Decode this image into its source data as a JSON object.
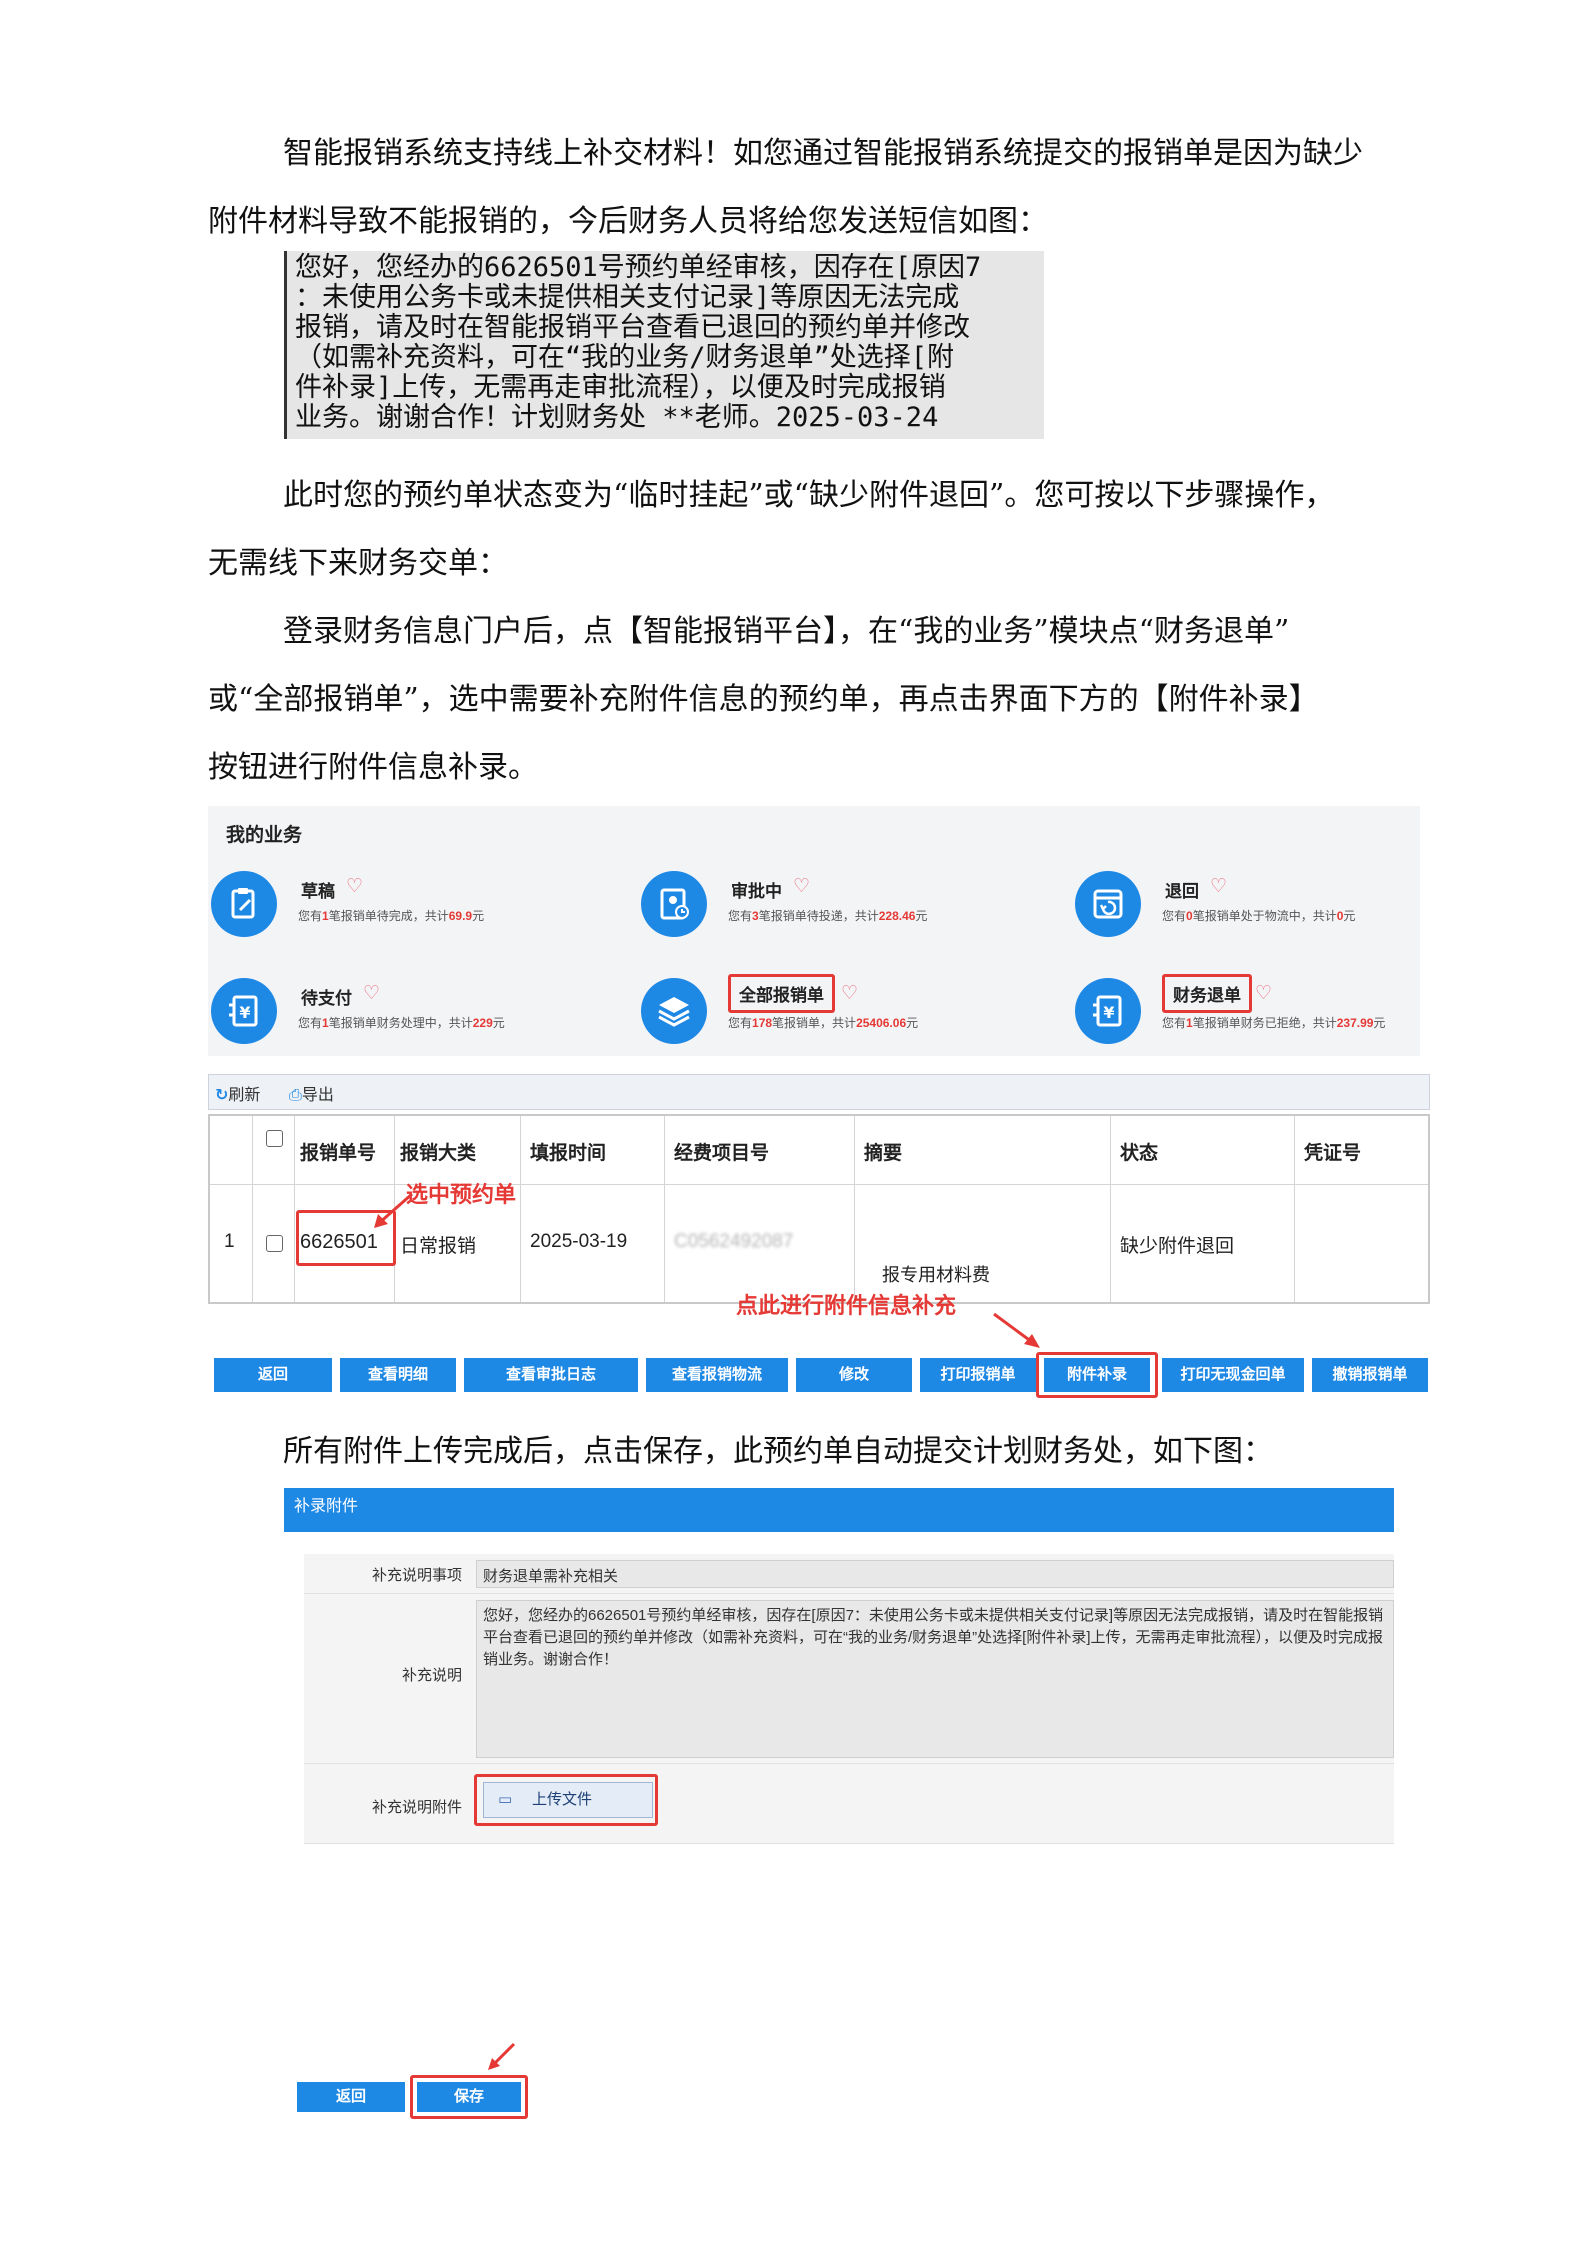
{
  "intro": {
    "line1": "智能报销系统支持线上补交材料！如您通过智能报销系统提交的报销单是因为缺少",
    "line2": "附件材料导致不能报销的，今后财务人员将给您发送短信如图："
  },
  "sms": "您好，您经办的6626501号预约单经审核，因存在[原因7\n：未使用公务卡或未提供相关支付记录]等原因无法完成\n报销，请及时在智能报销平台查看已退回的预约单并修改\n（如需补充资料，可在“我的业务/财务退单”处选择[附\n件补录]上传，无需再走审批流程），以便及时完成报销\n业务。谢谢合作！计划财务处 **老师。2025-03-24",
  "para2": {
    "line1": "此时您的预约单状态变为“临时挂起”或“缺少附件退回”。您可按以下步骤操作，",
    "line2": "无需线下来财务交单："
  },
  "para3": {
    "line1": "登录财务信息门户后，点【智能报销平台】，在“我的业务”模块点“财务退单”",
    "line2": "或“全部报销单”，选中需要补充附件信息的预约单，再点击界面下方的【附件补录】",
    "line3": "按钮进行附件信息补录。"
  },
  "business": {
    "title": "我的业务",
    "tiles": [
      {
        "name": "草稿",
        "desc_pre": "您有",
        "count": "1",
        "desc_mid": "笔报销单待完成，共计",
        "amount": "69.9",
        "desc_post": "元",
        "icon": "clipboard-edit-icon"
      },
      {
        "name": "审批中",
        "desc_pre": "您有",
        "count": "3",
        "desc_mid": "笔报销单待投递，共计",
        "amount": "228.46",
        "desc_post": "元",
        "icon": "badge-clock-icon"
      },
      {
        "name": "退回",
        "desc_pre": "您有",
        "count": "0",
        "desc_mid": "笔报销单处于物流中，共计",
        "amount": "0",
        "desc_post": "元",
        "icon": "return-icon"
      },
      {
        "name": "待支付",
        "desc_pre": "您有",
        "count": "1",
        "desc_mid": "笔报销单财务处理中，共计",
        "amount": "229",
        "desc_post": "元",
        "icon": "yuan-doc-icon"
      },
      {
        "name": "全部报销单",
        "desc_pre": "您有",
        "count": "178",
        "desc_mid": "笔报销单，共计",
        "amount": "25406.06",
        "desc_post": "元",
        "icon": "layers-icon"
      },
      {
        "name": "财务退单",
        "desc_pre": "您有",
        "count": "1",
        "desc_mid": "笔报销单财务已拒绝，共计",
        "amount": "237.99",
        "desc_post": "元",
        "icon": "yuan-doc-icon"
      }
    ]
  },
  "table": {
    "toolbar": {
      "refresh": "刷新",
      "export": "导出"
    },
    "headers": [
      "报销单号",
      "报销大类",
      "填报时间",
      "经费项目号",
      "摘要",
      "状态",
      "凭证号"
    ],
    "row": {
      "index": "1",
      "id": "6626501",
      "category": "日常报销",
      "date": "2025-03-19",
      "project": "C0562492087",
      "summary_line3": "报专用材料费",
      "status": "缺少附件退回"
    },
    "annot_select": "选中预约单",
    "annot_click": "点此进行附件信息补充",
    "buttons": [
      "返回",
      "查看明细",
      "查看审批日志",
      "查看报销物流",
      "修改",
      "打印报销单",
      "附件补录",
      "打印无现金回单",
      "撤销报销单"
    ]
  },
  "para4": "所有附件上传完成后，点击保存，此预约单自动提交计划财务处，如下图：",
  "attach": {
    "header": "补录附件",
    "label_item": "补充说明事项",
    "value_item": "财务退单需补充相关",
    "label_desc": "补充说明",
    "value_desc": "您好，您经办的6626501号预约单经审核，因存在[原因7：未使用公务卡或未提供相关支付记录]等原因无法完成报销，请及时在智能报销平台查看已退回的预约单并修改（如需补充资料，可在“我的业务/财务退单”处选择[附件补录]上传，无需再走审批流程），以便及时完成报销业务。谢谢合作！",
    "label_file": "补充说明附件",
    "upload": "上传文件"
  },
  "footer_buttons": {
    "back": "返回",
    "save": "保存"
  },
  "colors": {
    "accent": "#1e88e5",
    "highlight": "#e53935"
  }
}
